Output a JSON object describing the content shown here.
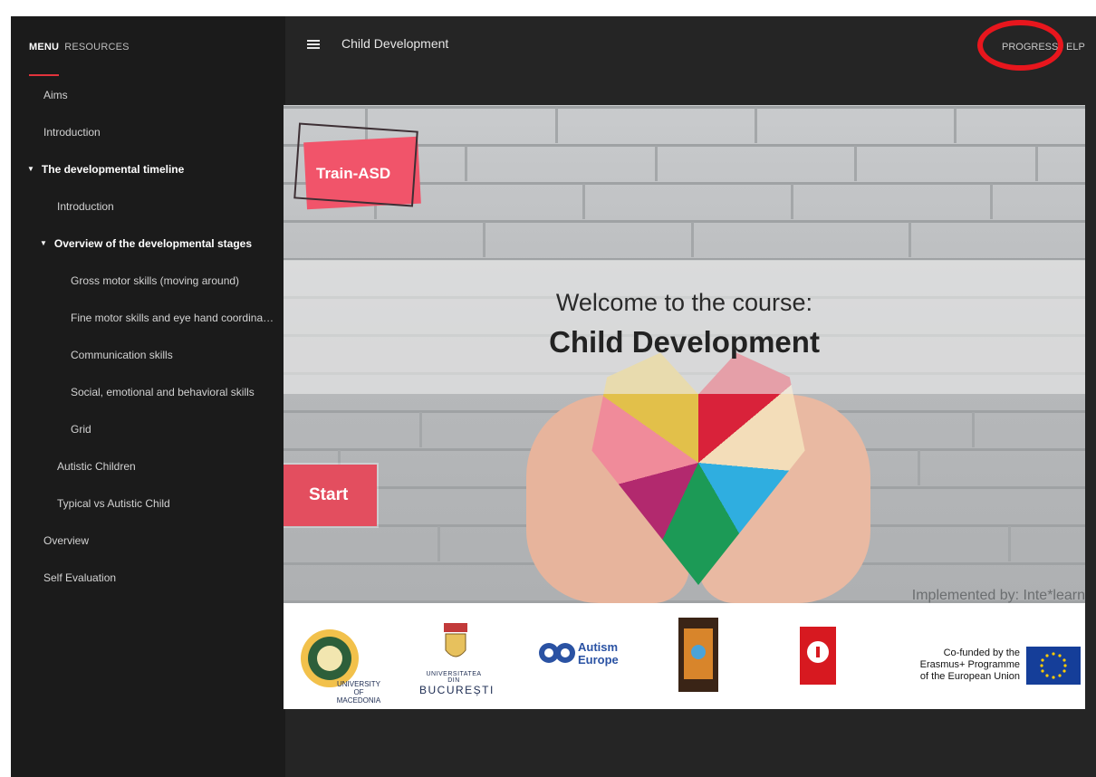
{
  "sidebar": {
    "tabs": [
      {
        "label": "MENU",
        "active": true
      },
      {
        "label": "RESOURCES",
        "active": false
      }
    ],
    "items": [
      {
        "label": "Aims",
        "level": 0,
        "expanded": false
      },
      {
        "label": "Introduction",
        "level": 0,
        "expanded": false
      },
      {
        "label": "The developmental timeline",
        "level": 0,
        "expanded": true
      },
      {
        "label": "Introduction",
        "level": 1,
        "expanded": false
      },
      {
        "label": "Overview of the developmental stages",
        "level": 1,
        "expanded": true
      },
      {
        "label": "Gross motor skills (moving around)",
        "level": 2
      },
      {
        "label": "Fine motor skills and eye hand coordinat...",
        "level": 2
      },
      {
        "label": "Communication skills",
        "level": 2
      },
      {
        "label": "Social, emotional and behavioral skills",
        "level": 2
      },
      {
        "label": "Grid",
        "level": 2
      },
      {
        "label": "Autistic Children",
        "level": 1
      },
      {
        "label": "Typical vs Autistic Child",
        "level": 1
      },
      {
        "label": "Overview",
        "level": 0
      },
      {
        "label": "Self Evaluation",
        "level": 0
      }
    ]
  },
  "topbar": {
    "course_title": "Child Development",
    "nav_progress": "PROGRESS",
    "nav_help": "ELP"
  },
  "hero": {
    "logo_text": "Train-ASD",
    "welcome": "Welcome to the course:",
    "course_name": "Child Development",
    "start_label": "Start",
    "implemented_by": "Implemented by: Inte*learn"
  },
  "sponsors": {
    "university_macedonia": "UNIVERSITY\nOF MACEDONIA",
    "bucuresti_line1": "UNIVERSITATEA DIN",
    "bucuresti_line2": "BUCUREȘTI",
    "autism_europe_line1": "Autism",
    "autism_europe_line2": "Europe",
    "cofunded": "Co-funded by the\nErasmus+ Programme\nof the European Union"
  },
  "colors": {
    "accent": "#e2333c",
    "annotation_circle": "#e8161d",
    "start_button": "#e34e5f",
    "logo_pink": "#f1546a"
  }
}
